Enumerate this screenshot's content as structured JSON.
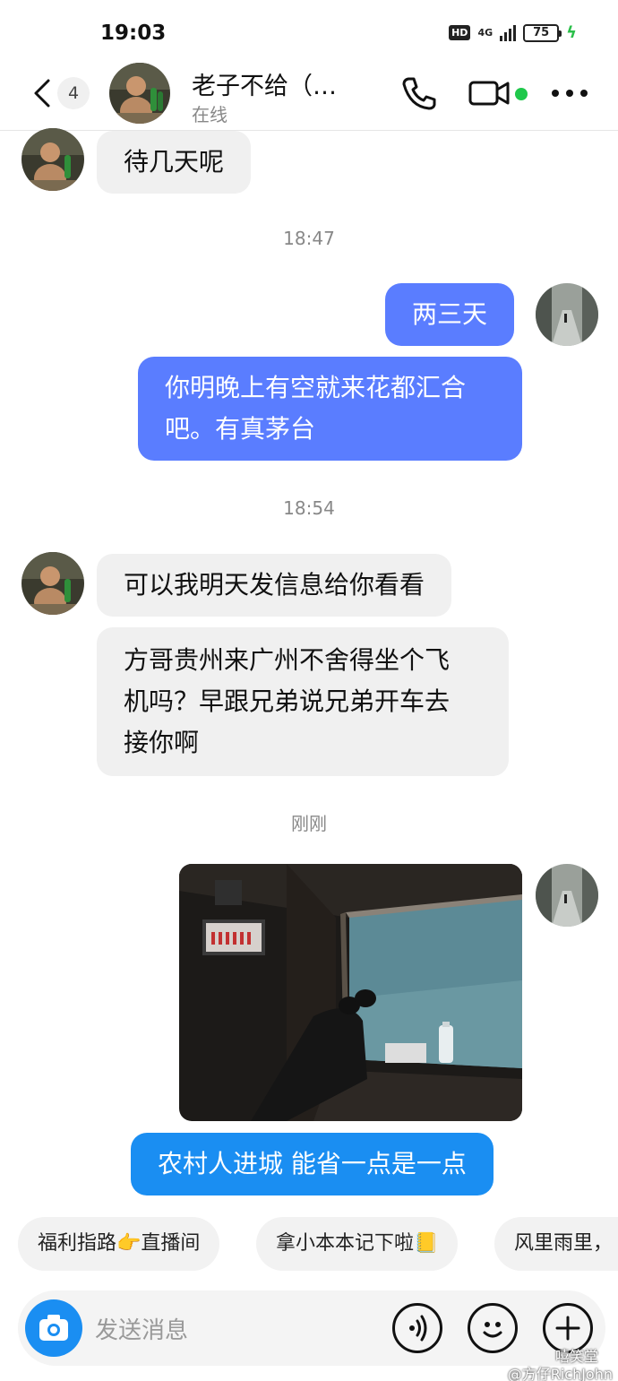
{
  "status_bar": {
    "time": "19:03",
    "hd": "HD",
    "network": "4G",
    "battery": "75"
  },
  "header": {
    "unread_count": "4",
    "contact_name": "老子不给（…",
    "presence": "在线"
  },
  "messages": {
    "m1": "待几天呢",
    "t1": "18:47",
    "m2": "两三天",
    "m3_line1": "你明晚上有空就来花都汇合",
    "m3_line2": "吧。有真茅台",
    "t2": "18:54",
    "m4": "可以我明天发信息给你看看",
    "m5_line1": "方哥贵州来广州不舍得坐个飞",
    "m5_line2": "机吗？早跟兄弟说兄弟开车去",
    "m5_line3": "接你啊",
    "t3": "刚刚",
    "m6": "农村人进城 能省一点是一点"
  },
  "quick_replies": {
    "chip1": "福利指路👉直播间",
    "chip2": "拿小本本记下啦📒",
    "chip3": "风里雨里，"
  },
  "input": {
    "placeholder": "发送消息"
  },
  "watermark": {
    "line1": "嘻笑堂",
    "line2": "@方仔RichJohn"
  },
  "colors": {
    "outgoing_bubble": "#5a7dff",
    "outgoing_bubble_alt": "#1a8ef2",
    "incoming_bubble": "#f0f0f0",
    "online": "#1fc84b"
  }
}
